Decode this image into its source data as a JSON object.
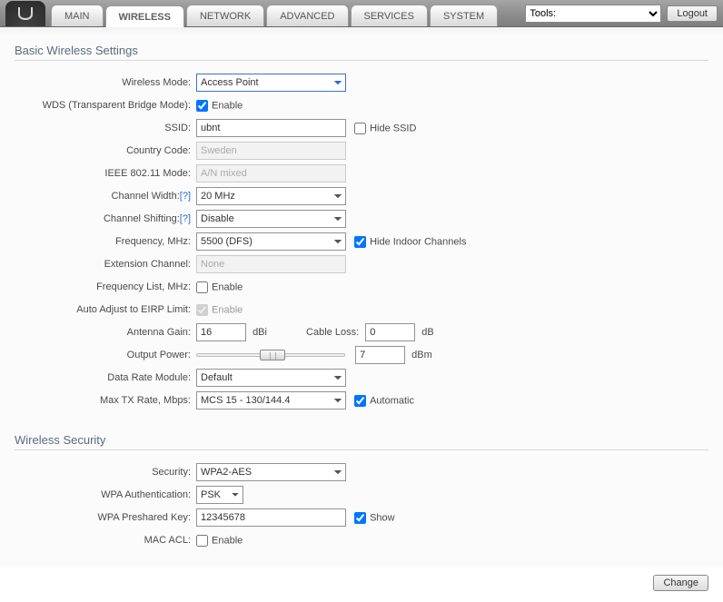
{
  "topbar": {
    "tabs": [
      "MAIN",
      "WIRELESS",
      "NETWORK",
      "ADVANCED",
      "SERVICES",
      "SYSTEM"
    ],
    "active_tab": 1,
    "tools_label": "Tools:",
    "logout": "Logout"
  },
  "sections": {
    "basic_title": "Basic Wireless Settings",
    "security_title": "Wireless Security"
  },
  "labels": {
    "wireless_mode": "Wireless Mode:",
    "wds": "WDS (Transparent Bridge Mode):",
    "ssid": "SSID:",
    "hide_ssid": "Hide SSID",
    "country": "Country Code:",
    "ieee": "IEEE 802.11 Mode:",
    "chwidth": "Channel Width:",
    "chshift": "Channel Shifting:",
    "freq": "Frequency, MHz:",
    "hide_indoor": "Hide Indoor Channels",
    "ext_channel": "Extension Channel:",
    "freq_list": "Frequency List, MHz:",
    "eirp": "Auto Adjust to EIRP Limit:",
    "antenna_gain": "Antenna Gain:",
    "cable_loss": "Cable Loss:",
    "output_power": "Output Power:",
    "data_rate": "Data Rate Module:",
    "max_tx": "Max TX Rate, Mbps:",
    "security": "Security:",
    "wpa_auth": "WPA Authentication:",
    "wpa_psk": "WPA Preshared Key:",
    "mac_acl": "MAC ACL:",
    "enable": "Enable",
    "automatic": "Automatic",
    "show": "Show",
    "help": "[?]",
    "dbi": "dBi",
    "db": "dB",
    "dbm": "dBm"
  },
  "values": {
    "wireless_mode": "Access Point",
    "wds_enable": true,
    "ssid": "ubnt",
    "hide_ssid": false,
    "country": "Sweden",
    "ieee": "A/N mixed",
    "chwidth": "20 MHz",
    "chshift": "Disable",
    "freq": "5500 (DFS)",
    "hide_indoor": true,
    "ext_channel": "None",
    "freq_list_enable": false,
    "eirp_enable": true,
    "antenna_gain": "16",
    "cable_loss": "0",
    "output_power": "7",
    "data_rate": "Default",
    "max_tx": "MCS 15 - 130/144.4",
    "automatic": true,
    "security": "WPA2-AES",
    "wpa_auth": "PSK",
    "wpa_psk": "12345678",
    "show_psk": true,
    "mac_acl_enable": false
  },
  "footer": {
    "change": "Change"
  }
}
